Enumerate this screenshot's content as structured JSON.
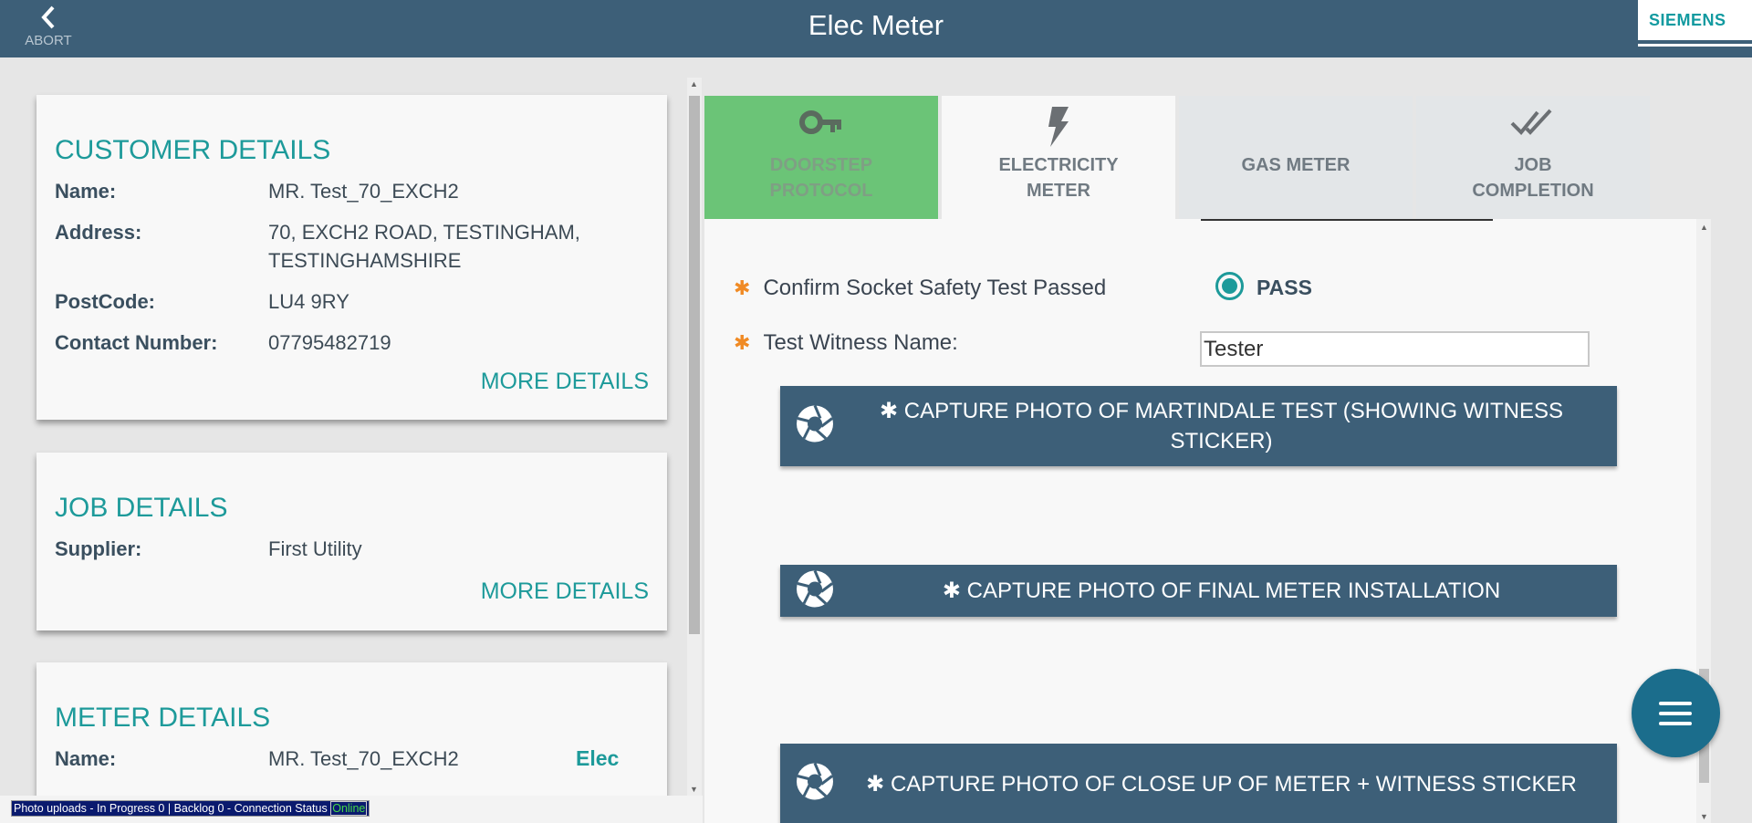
{
  "header": {
    "title": "Elec Meter",
    "abort_label": "ABORT",
    "brand": "SIEMENS"
  },
  "customer": {
    "heading": "CUSTOMER DETAILS",
    "fields": [
      {
        "label": "Name:",
        "value": "MR. Test_70_EXCH2"
      },
      {
        "label": "Address:",
        "value": "70, EXCH2 ROAD, TESTINGHAM, TESTINGHAMSHIRE"
      },
      {
        "label": "PostCode:",
        "value": "LU4 9RY"
      },
      {
        "label": "Contact Number:",
        "value": "07795482719"
      }
    ],
    "more": "MORE DETAILS"
  },
  "job": {
    "heading": "JOB DETAILS",
    "fields": [
      {
        "label": "Supplier:",
        "value": "First Utility"
      }
    ],
    "more": "MORE DETAILS"
  },
  "meter": {
    "heading": "METER DETAILS",
    "name_label": "Name:",
    "name_value": "MR. Test_70_EXCH2",
    "type": "Elec"
  },
  "tabs": [
    {
      "line1": "DOORSTEP",
      "line2": "PROTOCOL",
      "icon": "key-icon"
    },
    {
      "line1": "ELECTRICITY",
      "line2": "METER",
      "icon": "lightning-icon"
    },
    {
      "line1": "GAS METER",
      "line2": "",
      "icon": ""
    },
    {
      "line1": "JOB",
      "line2": "COMPLETION",
      "icon": "double-check-icon"
    }
  ],
  "form": {
    "socket_label": "Confirm Socket Safety Test Passed",
    "socket_value": "PASS",
    "witness_label": "Test Witness Name:",
    "witness_value": "Tester"
  },
  "captures": [
    {
      "label": "CAPTURE PHOTO OF MARTINDALE TEST (SHOWING WITNESS STICKER)"
    },
    {
      "label": "CAPTURE PHOTO OF FINAL METER INSTALLATION"
    },
    {
      "label": "CAPTURE PHOTO OF CLOSE UP OF METER + WITNESS STICKER"
    }
  ],
  "status_bar": {
    "text": "Photo uploads - In Progress 0 | Backlog 0 - Connection Status",
    "connection": "Online"
  },
  "colors": {
    "header": "#3d5f78",
    "accent": "#1d9a9a",
    "doorstep_tab": "#6bc477",
    "required_star": "#f08a24",
    "fab": "#1b6d8c"
  }
}
